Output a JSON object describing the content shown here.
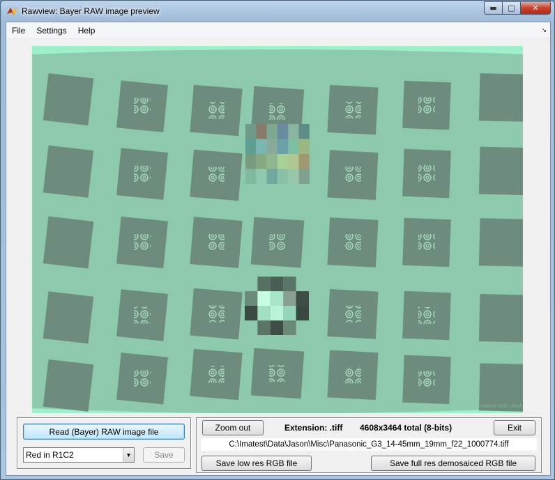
{
  "window": {
    "title": "Rawview: Bayer RAW image preview",
    "controls": {
      "minimize": "▬",
      "maximize": "□",
      "close": "✕"
    }
  },
  "menu": {
    "items": [
      "File",
      "Settings",
      "Help"
    ],
    "dock_arrow": "↘"
  },
  "image": {
    "description_icon": "test-chart-image",
    "watermark": "Imatest test chart",
    "colors": {
      "background": "#8dc9ac",
      "square": "#6d8c7e",
      "light": "#a7f2cf"
    }
  },
  "left_panel": {
    "read_button": "Read (Bayer) RAW image file",
    "channel_select": "Red in R1C2",
    "save_button": "Save"
  },
  "right_panel": {
    "zoom_out": "Zoom out",
    "extension_label": "Extension:  .tiff",
    "size_info": "4608x3464 total  (8-bits)",
    "exit": "Exit",
    "file_path": "C:\\Imatest\\Data\\Jason\\Misc\\Panasonic_G3_14-45mm_19mm_f22_1000774.tiff",
    "save_low_res": "Save low res RGB file",
    "save_full_res": "Save full res demosaiced RGB file"
  }
}
